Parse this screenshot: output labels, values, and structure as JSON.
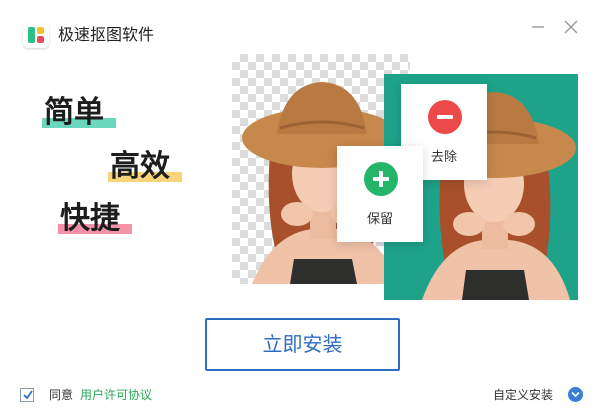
{
  "app": {
    "title": "极速抠图软件",
    "colors": {
      "accent": "#2d6ec3",
      "logo_green": "#2cbf86",
      "logo_yellow": "#f2c12e",
      "logo_red": "#ec4a62"
    }
  },
  "window_controls": {
    "minimize_icon": "minimize-icon",
    "close_icon": "close-icon"
  },
  "slogans": [
    {
      "text": "简单",
      "underline_color": "#39c9a9"
    },
    {
      "text": "高效",
      "underline_color": "#f6c64c"
    },
    {
      "text": "快捷",
      "underline_color": "#f06b8a"
    }
  ],
  "preview": {
    "left_background": "transparent-checkerboard",
    "right_background_color": "#1ea38a",
    "remove_card": {
      "label": "去除",
      "icon": "minus-circle-icon",
      "color": "#ec4a4a"
    },
    "keep_card": {
      "label": "保留",
      "icon": "plus-circle-icon",
      "color": "#25b56a"
    }
  },
  "install": {
    "label": "立即安装"
  },
  "footer": {
    "agree_checked": true,
    "agree_label": "同意",
    "license_link": "用户许可协议",
    "custom_install_label": "自定义安装",
    "custom_install_icon": "chevron-down-circle-icon"
  }
}
